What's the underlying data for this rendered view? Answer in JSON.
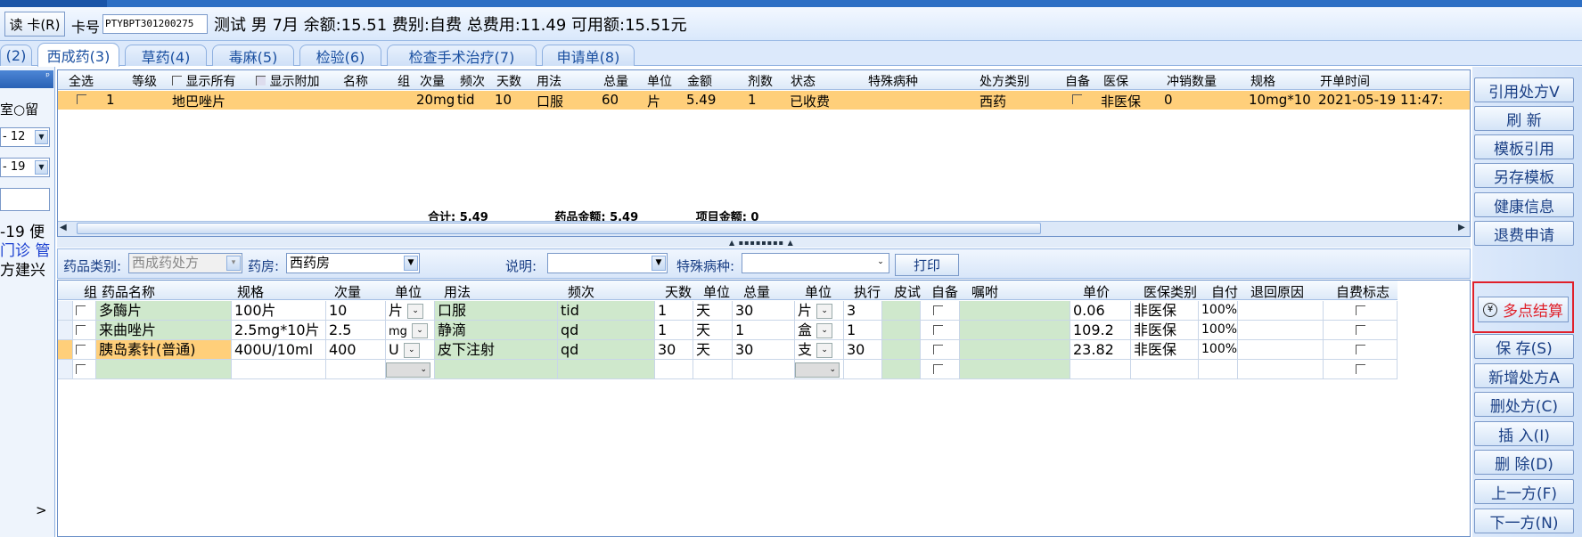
{
  "header": {
    "read_card_button": "读 卡(R)",
    "card_label": "卡号",
    "card_number": "PTYBPT301200275",
    "patient_info": "测试 男 7月 余额:15.51 费别:自费 总费用:11.49 可用额:15.51元"
  },
  "tabs": [
    {
      "label": "(2)"
    },
    {
      "label": "西成药(3)",
      "active": true
    },
    {
      "label": "草药(4)"
    },
    {
      "label": "毒麻(5)"
    },
    {
      "label": "检验(6)"
    },
    {
      "label": "检查手术治疗(7)"
    },
    {
      "label": "申请单(8)"
    }
  ],
  "left_panel": {
    "pin": "ᵖ",
    "radio_text": "室○留",
    "select1": "- 12",
    "select2": "- 19",
    "line1": "-19 便",
    "line2": "门诊 管",
    "line3": "方建兴",
    "scroll_arrow": ">"
  },
  "upper_grid": {
    "headers": {
      "select_all": "全选",
      "level": "等级",
      "show_all": "显示所有",
      "show_extra": "显示附加",
      "name": "名称",
      "group": "组",
      "dose": "次量",
      "freq": "频次",
      "days": "天数",
      "usage": "用法",
      "total": "总量",
      "unit": "单位",
      "amount": "金额",
      "doses": "剂数",
      "status": "状态",
      "special": "特殊病种",
      "rx_type": "处方类别",
      "self_prep": "自备",
      "insurance": "医保",
      "refund_qty": "冲销数量",
      "spec": "规格",
      "open_time": "开单时间"
    },
    "row": {
      "level": "1",
      "name": "地巴唑片",
      "dose": "20mg",
      "freq": "tid",
      "days": "10",
      "usage": "口服",
      "total": "60",
      "unit": "片",
      "amount": "5.49",
      "doses": "1",
      "status": "已收费",
      "rx_type": "西药",
      "insurance": "非医保",
      "refund_qty": "0",
      "spec": "10mg*10",
      "open_time": "2021-05-19 11:47:"
    },
    "totals": {
      "sum": "合计: 5.49",
      "drug_amount": "药品金额: 5.49",
      "item_amount": "项目金额: 0"
    }
  },
  "filter_bar": {
    "drug_category_label": "药品类别:",
    "drug_category_value": "西成药处方",
    "pharmacy_label": "药房:",
    "pharmacy_value": "西药房",
    "note_label": "说明:",
    "note_value": "",
    "special_label": "特殊病种:",
    "special_value": "",
    "print_button": "打印"
  },
  "lower_grid": {
    "headers": [
      "组",
      "药品名称",
      "规格",
      "次量",
      "单位",
      "用法",
      "频次",
      "天数",
      "单位",
      "总量",
      "单位",
      "执行",
      "皮试",
      "自备",
      "嘱咐",
      "单价",
      "医保类别",
      "自付",
      "退回原因",
      "自费标志"
    ],
    "rows": [
      {
        "name": "多酶片",
        "spec": "100片",
        "dose": "10",
        "unit": "片",
        "usage": "口服",
        "freq": "tid",
        "days": "1",
        "day_unit": "天",
        "total": "30",
        "total_unit": "片",
        "exec": "3",
        "price": "0.06",
        "ins_type": "非医保",
        "self_pay": "100%"
      },
      {
        "name": "来曲唑片",
        "spec": "2.5mg*10片",
        "dose": "2.5",
        "unit": "mg",
        "usage": "静滴",
        "freq": "qd",
        "days": "1",
        "day_unit": "天",
        "total": "1",
        "total_unit": "盒",
        "exec": "1",
        "price": "109.2",
        "ins_type": "非医保",
        "self_pay": "100%"
      },
      {
        "name": "胰岛素针(普通)",
        "spec": "400U/10ml",
        "dose": "400",
        "unit": "U",
        "usage": "皮下注射",
        "freq": "qd",
        "days": "30",
        "day_unit": "天",
        "total": "30",
        "total_unit": "支",
        "exec": "30",
        "price": "23.82",
        "ins_type": "非医保",
        "self_pay": "100%"
      },
      {
        "name": "",
        "spec": "",
        "dose": "",
        "unit": "",
        "usage": "",
        "freq": "",
        "days": "",
        "day_unit": "",
        "total": "",
        "total_unit": "",
        "exec": "",
        "price": "",
        "ins_type": "",
        "self_pay": ""
      }
    ]
  },
  "right_buttons": {
    "cite_rx": "引用处方V",
    "refresh": "刷 新",
    "template_cite": "模板引用",
    "save_template": "另存模板",
    "health_info": "健康信息",
    "refund_apply": "退费申请",
    "multi_settle": "多点结算",
    "save": "保 存(S)",
    "new_rx": "新增处方A",
    "delete_rx": "删处方(C)",
    "insert": "插 入(I)",
    "delete": "删 除(D)",
    "prev_rx": "上一方(F)",
    "next_rx": "下一方(N)"
  },
  "colors": {
    "selected_row": "#ffcf7a",
    "editable_cell": "#cfe8cc",
    "highlight_border": "#e0202a",
    "accent": "#2d6fc4"
  }
}
